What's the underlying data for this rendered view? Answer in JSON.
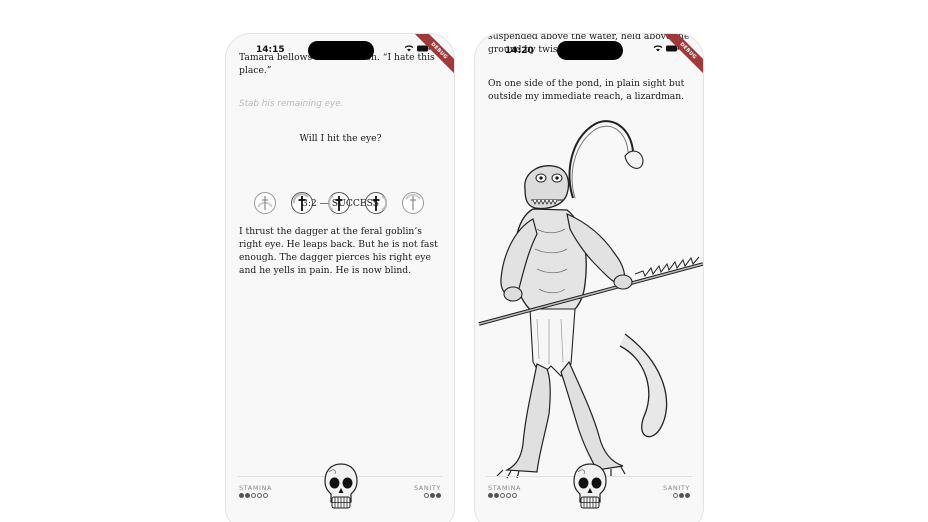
{
  "left": {
    "status_time": "14:15",
    "debug_label": "DEBUG",
    "intro_text": "Tamara bellows in frustration. “I hate this place.”",
    "choice_text": "Stab his remaining eye.",
    "question": "Will I hit the eye?",
    "dice": [
      {
        "state": "faded"
      },
      {
        "state": "success"
      },
      {
        "state": "success"
      },
      {
        "state": "success"
      },
      {
        "state": "faded"
      }
    ],
    "result": "3:2 — SUCCESS",
    "outcome_text": "I thrust the dagger at the feral goblin’s right eye. He leaps back. But he is not fast enough. The dagger pierces his right eye and he yells in pain. He is now blind.",
    "stamina_label": "STAMINA",
    "sanity_label": "SANITY",
    "stamina_dots": [
      1,
      1,
      0,
      0,
      0
    ],
    "sanity_dots": [
      0,
      1,
      1
    ]
  },
  "right": {
    "status_time": "14:20",
    "debug_label": "DEBUG",
    "top_text": "suspended above the water, held above the ground by twisted branches.",
    "body_text": "On one side of the pond, in plain sight but outside my immediate reach, a lizardman.",
    "illustration": "lizardman-with-sword",
    "stamina_label": "STAMINA",
    "sanity_label": "SANITY",
    "stamina_dots": [
      1,
      1,
      0,
      0,
      0
    ],
    "sanity_dots": [
      0,
      1,
      1
    ]
  },
  "colors": {
    "debug_ribbon": "#a03a3a",
    "text": "#1b1b1b",
    "choice": "#b9b9b9"
  }
}
